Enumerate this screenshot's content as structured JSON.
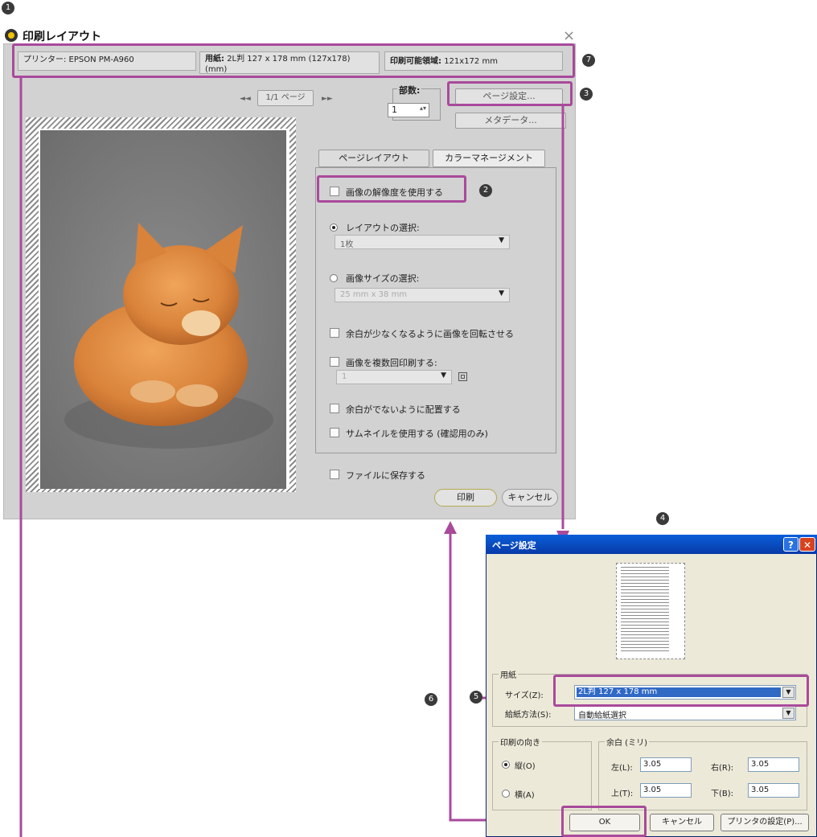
{
  "callouts": [
    "1",
    "2",
    "3",
    "4",
    "5",
    "6",
    "7"
  ],
  "main": {
    "title": "印刷レイアウト",
    "close": "×",
    "printer": "プリンター:  EPSON PM-A960",
    "paper_label": "用紙:",
    "paper_value": "2L判 127 x 178 mm (127x178) (mm)",
    "printable_label": "印刷可能領域:",
    "printable_value": "121x172 mm",
    "page_nav": {
      "prev": "◄◄",
      "page": "1/1 ページ",
      "next": "►►"
    },
    "copies_label": "部数:",
    "copies_value": "1",
    "page_setup_button": "ページ設定...",
    "metadata_button": "メタデータ...",
    "tabs": [
      "ページレイアウト",
      "カラーマネージメント"
    ],
    "use_resolution": "画像の解像度を使用する",
    "layout_select_label": "レイアウトの選択:",
    "layout_select_value": "1枚",
    "image_size_label": "画像サイズの選択:",
    "image_size_value": "25 mm x 38 mm",
    "rotate_option": "余白が少なくなるように画像を回転させる",
    "multi_print_option": "画像を複数回印刷する:",
    "multi_print_value": "1",
    "no_margin_option": "余白がでないように配置する",
    "thumbnail_option": "サムネイルを使用する (確認用のみ)",
    "save_to_file": "ファイルに保存する",
    "print_button": "印刷",
    "cancel_button": "キャンセル"
  },
  "page_setup": {
    "title": "ページ設定",
    "help": "?",
    "close": "✕",
    "paper_group": "用紙",
    "size_label": "サイズ(Z):",
    "size_value": "2L判 127 x 178 mm",
    "source_label": "給紙方法(S):",
    "source_value": "自動給紙選択",
    "orientation_group": "印刷の向き",
    "portrait": "縦(O)",
    "landscape": "横(A)",
    "margin_group": "余白 (ミリ)",
    "left_label": "左(L):",
    "left_value": "3.05",
    "right_label": "右(R):",
    "right_value": "3.05",
    "top_label": "上(T):",
    "top_value": "3.05",
    "bottom_label": "下(B):",
    "bottom_value": "3.05",
    "ok_button": "OK",
    "cancel_button": "キャンセル",
    "printer_button": "プリンタの設定(P)..."
  },
  "colors": {
    "highlight": "#a94a9b",
    "xp_title": "#0a5fd8",
    "selection": "#316ac5"
  }
}
